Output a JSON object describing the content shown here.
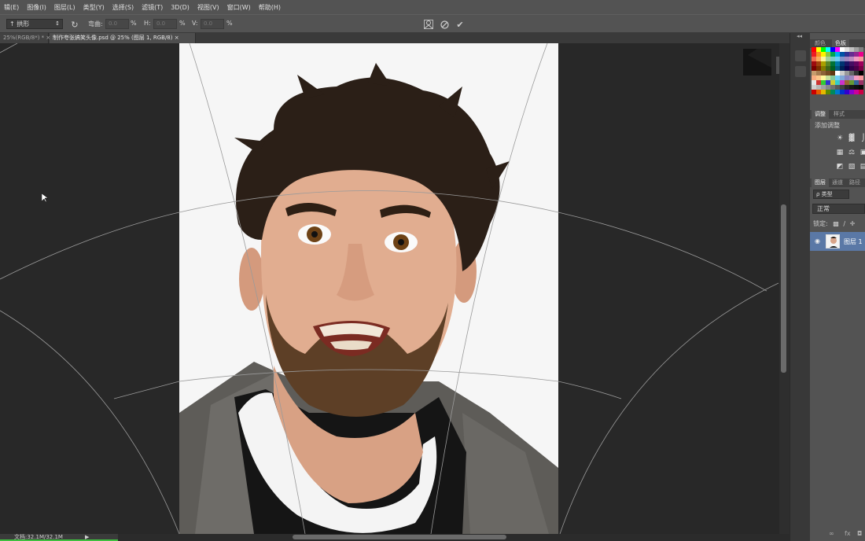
{
  "menu": [
    "辑(E)",
    "图像(I)",
    "图层(L)",
    "类型(Y)",
    "选择(S)",
    "滤镜(T)",
    "3D(D)",
    "视图(V)",
    "窗口(W)",
    "帮助(H)"
  ],
  "options": {
    "warp_style": "拱形",
    "bend_label": "弯曲:",
    "bend_value": "0.0",
    "h_label": "H:",
    "h_value": "0.0",
    "v_label": "V:",
    "v_value": "0.0",
    "percent": "%"
  },
  "tabs": [
    {
      "label": "25%(RGB/8*) *  ×"
    },
    {
      "label": "制作夸张搞笑头像.psd @ 25% (图层 1, RGB/8)  ×"
    }
  ],
  "status": {
    "doc": "文档:32.1M/32.1M"
  },
  "panels": {
    "color_tabs": [
      "颜色",
      "色板"
    ],
    "adjust_tabs": [
      "调整",
      "样式"
    ],
    "add_adjustment": "添加调整",
    "layers_tabs": [
      "图层",
      "通道",
      "路径"
    ],
    "filter": "ρ 类型",
    "blend_mode": "正常",
    "lock": "锁定:",
    "layer_name": "图层 1"
  },
  "colors": {
    "ui_gray": "#535353",
    "canvas_bg": "#282828",
    "selected_layer": "#5a78a6"
  }
}
